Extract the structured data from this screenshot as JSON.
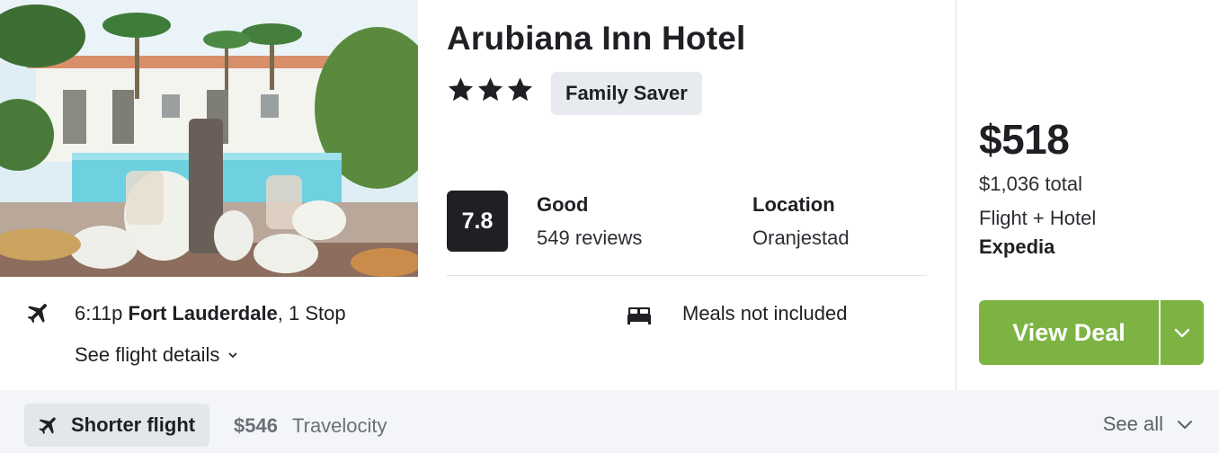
{
  "hotel": {
    "name": "Arubiana Inn Hotel",
    "star_count": 3,
    "badge": "Family Saver",
    "score": "7.8",
    "rating_label": "Good",
    "reviews": "549 reviews",
    "location_label": "Location",
    "location_value": "Oranjestad",
    "photo_icon": "hotel-photo"
  },
  "flight": {
    "icon": "airplane-icon",
    "time": "6:11p",
    "city": "Fort Lauderdale",
    "stops": ", 1 Stop",
    "details_link": "See flight details"
  },
  "meals": {
    "icon": "bed-icon",
    "text": "Meals not included"
  },
  "pricing": {
    "price": "$518",
    "total": "$1,036 total",
    "package": "Flight + Hotel",
    "provider": "Expedia",
    "cta": "View Deal"
  },
  "footer": {
    "chip_label": "Shorter flight",
    "alt_price": "$546",
    "alt_provider": "Travelocity",
    "see_all": "See all"
  },
  "colors": {
    "accent_green": "#7cb342",
    "score_bg": "#1e2024",
    "footer_bg": "#f3f5f8"
  }
}
